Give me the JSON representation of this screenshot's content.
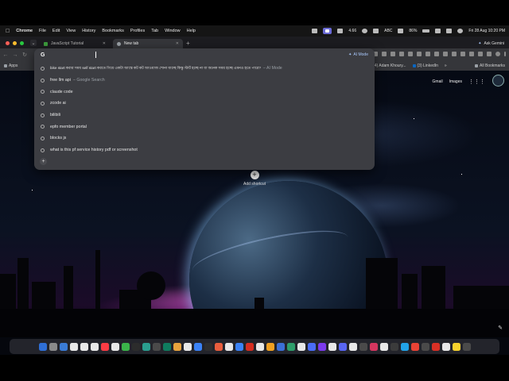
{
  "menubar": {
    "app": "Chrome",
    "items": [
      "File",
      "Edit",
      "View",
      "History",
      "Bookmarks",
      "Profiles",
      "Tab",
      "Window",
      "Help"
    ],
    "status_speed": "4.66",
    "input_method": "ABC",
    "battery": "86%",
    "clock": "Fri 28 Aug 10:20 PM"
  },
  "tabs": [
    {
      "label": "JavaScript Tutorial",
      "color": "#3c9b3c"
    },
    {
      "label": "New tab",
      "color": "#9aa0a6"
    }
  ],
  "ask_gemini": "Ask Gemini",
  "omnibox": {
    "logo": "G",
    "ai_mode": "AI Mode",
    "suggestions": [
      {
        "text": "bike start করার সময় self start করতে গিয়ে একটা আস্তে কট কট আওয়াজ শোনা যাচ্ছে কিন্তু স্টার্ট হচ্ছে না বা অনেক সময় হচ্ছে এমনও হতে পারে?",
        "sub": "– AI Mode"
      },
      {
        "text": "free llm api",
        "sub": "– Google Search"
      },
      {
        "text": "claude code",
        "sub": ""
      },
      {
        "text": "zcode ai",
        "sub": ""
      },
      {
        "text": "bilibili",
        "sub": ""
      },
      {
        "text": "epfo member portal",
        "sub": ""
      },
      {
        "text": "blocks js",
        "sub": ""
      },
      {
        "text": "what is this pf service history pdf or screenshot",
        "sub": ""
      }
    ]
  },
  "bookmarks": {
    "apps": "Apps",
    "right_items": [
      "(14) Adam Khoury...",
      "(3) LinkedIn"
    ],
    "all_bookmarks": "All Bookmarks"
  },
  "newtab": {
    "gmail": "Gmail",
    "images": "Images",
    "add_shortcut": "Add shortcut"
  },
  "dock_colors": [
    "#2f6fd6",
    "#8a8a8a",
    "#3a7bd5",
    "#e8e8e8",
    "#e8e8e8",
    "#e8e8e8",
    "#fc3c44",
    "#e8e8e8",
    "#3bb44a",
    "#2c2c2c",
    "#2a9d8f",
    "#4a4a4a",
    "#0f7c5f",
    "#e8a33d",
    "#e8e8e8",
    "#3b82f6",
    "#2e2e2e",
    "#e85d3d",
    "#e8e8e8",
    "#3b82f6",
    "#d62d20",
    "#e8e8e8",
    "#f0a020",
    "#3b6fd6",
    "#2e9e6a",
    "#e8e8e8",
    "#4a6cf7",
    "#7c3aed",
    "#e8e8e8",
    "#5865f2",
    "#e8e8e8",
    "#4a4a4a",
    "#d6365f",
    "#e8e8e8",
    "#3b3b3b",
    "#22a3e8",
    "#ea4335",
    "#4a4a4a",
    "#d93025",
    "#e8e8e8",
    "#f7d22d",
    "#4a4a4a"
  ]
}
